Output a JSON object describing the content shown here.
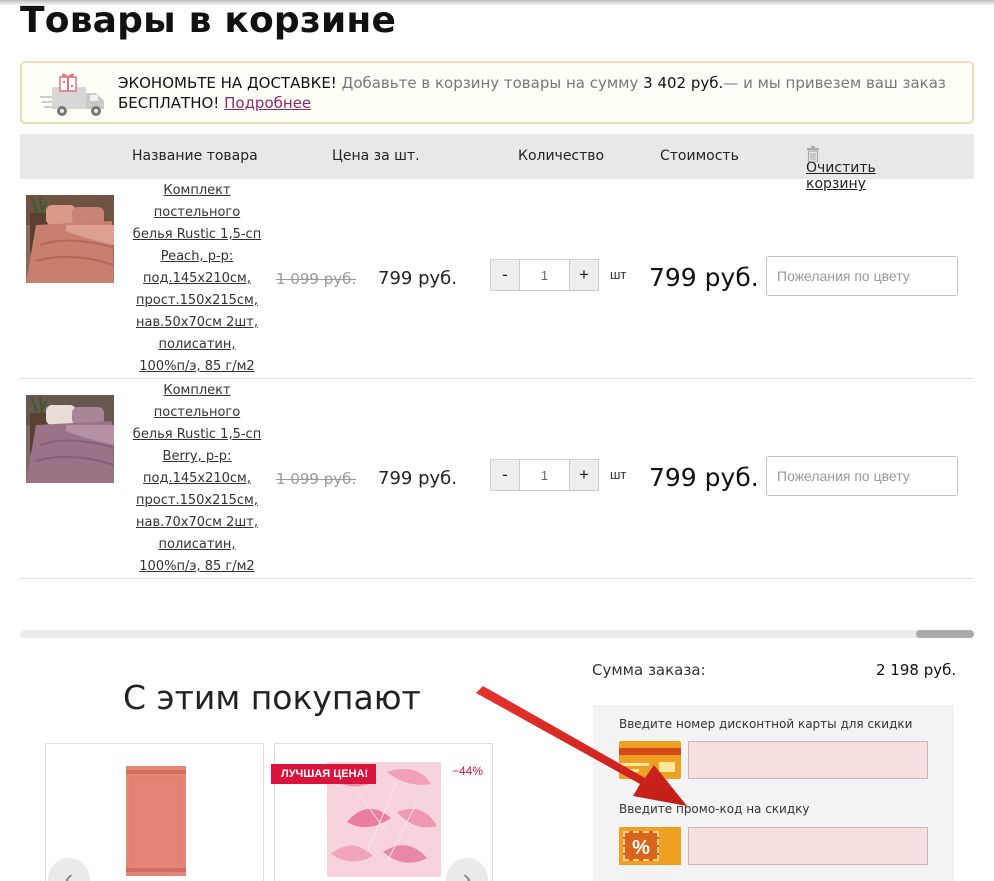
{
  "page": {
    "title": "Товары в корзине"
  },
  "banner": {
    "headline": "ЭКОНОМЬТЕ НА ДОСТАВКЕ!",
    "text_before_amount": " Добавьте в корзину товары на сумму ",
    "amount": "3 402 руб.",
    "text_after_amount": "— и мы привезем ваш заказ",
    "free": "БЕСПЛАТНО!",
    "link": "Подробнее",
    "icon": "delivery-truck-gift-icon"
  },
  "table": {
    "headers": {
      "name": "Название товара",
      "price": "Цена за шт.",
      "quantity": "Количество",
      "cost": "Стоимость",
      "clear": "Очистить корзину"
    },
    "rows": [
      {
        "name": "Комплект постельного белья Rustic 1,5-сп Peach, р-р: под.145х210см, прост.150х215см, нав.50х70см 2шт, полисатин, 100%п/э, 85 г/м2",
        "old_price": "1 099 руб.",
        "price": "799 руб.",
        "minus": "-",
        "qty": "1",
        "plus": "+",
        "unit": "шт",
        "cost": "799 руб.",
        "wish_placeholder": "Пожелания по цвету",
        "color": "#c98476"
      },
      {
        "name": "Комплект постельного белья Rustic 1,5-сп Berry, р-р: под.145х210см, прост.150х215см, нав.70х70см 2шт, полисатин, 100%п/э, 85 г/м2",
        "old_price": "1 099 руб.",
        "price": "799 руб.",
        "minus": "-",
        "qty": "1",
        "plus": "+",
        "unit": "шт",
        "cost": "799 руб.",
        "wish_placeholder": "Пожелания по цвету",
        "color": "#9c7386"
      }
    ]
  },
  "recommend": {
    "title": "С этим покупают",
    "badge": "ЛУЧШАЯ ЦЕНА!",
    "discount": "−44%",
    "prev": "‹",
    "next": "›"
  },
  "order": {
    "sum_label": "Сумма заказа:",
    "sum_value": "2 198 руб.",
    "card_label": "Введите номер дисконтной карты для скидки",
    "promo_label": "Введите промо-код на скидку",
    "promo_symbol": "%"
  },
  "colors": {
    "accent_red": "#d9143c",
    "link_purple": "#8a2a6b",
    "promo_orange": "#f0a020",
    "input_pink": "#f7dfe0"
  }
}
